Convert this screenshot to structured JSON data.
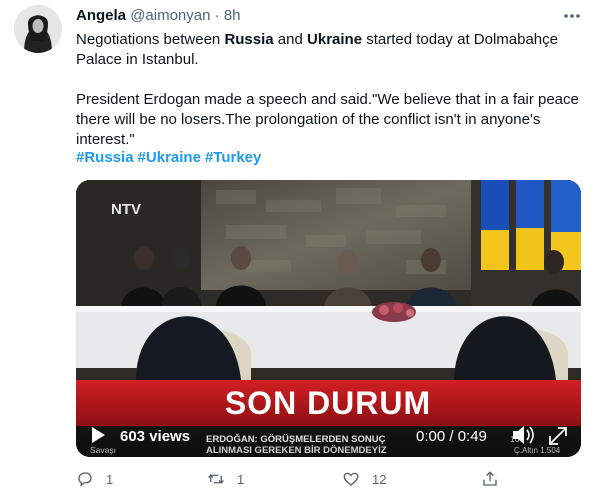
{
  "tweet": {
    "author_name": "Angela",
    "handle": "@aimonyan",
    "separator": "·",
    "time": "8h",
    "line1_a": "Negotiations between ",
    "line1_b": "Russia",
    "line1_c": " and ",
    "line1_d": "Ukraine",
    "line1_e": " started today at Dolmabahçe Palace in Istanbul.",
    "line2": "President Erdogan made a speech and said.\"We believe that in a fair peace there will be no losers.The prolongation of the conflict isn't in anyone's interest.\"",
    "hashtags": [
      "#Russia",
      "#Ukraine",
      "#Turkey"
    ]
  },
  "video": {
    "channel_logo": "NTV",
    "banner": "SON DURUM",
    "ticker_1": "ERDOĞAN: GÖRÜŞMELERDEN SONUÇ",
    "ticker_2": "ALINMASI GEREKEN BİR DÖNEMDEYİZ",
    "ticker_left": "Savaşı",
    "ticker_right_top": "10",
    "ticker_right_bottom": "Ç.Altın 1.504",
    "views": "603 views",
    "timestamp": "0:00 / 0:49",
    "progress": 0.0,
    "icons": {
      "play": "play-icon",
      "volume": "volume-icon",
      "fullscreen": "fullscreen-icon"
    }
  },
  "actions": {
    "reply_count": "1",
    "retweet_count": "1",
    "like_count": "12",
    "icons": [
      "reply-icon",
      "retweet-icon",
      "like-icon",
      "share-icon"
    ]
  },
  "colors": {
    "hashtag": "#1d9bf0",
    "banner_red": "#c4161c",
    "secondary_text": "#536471"
  }
}
